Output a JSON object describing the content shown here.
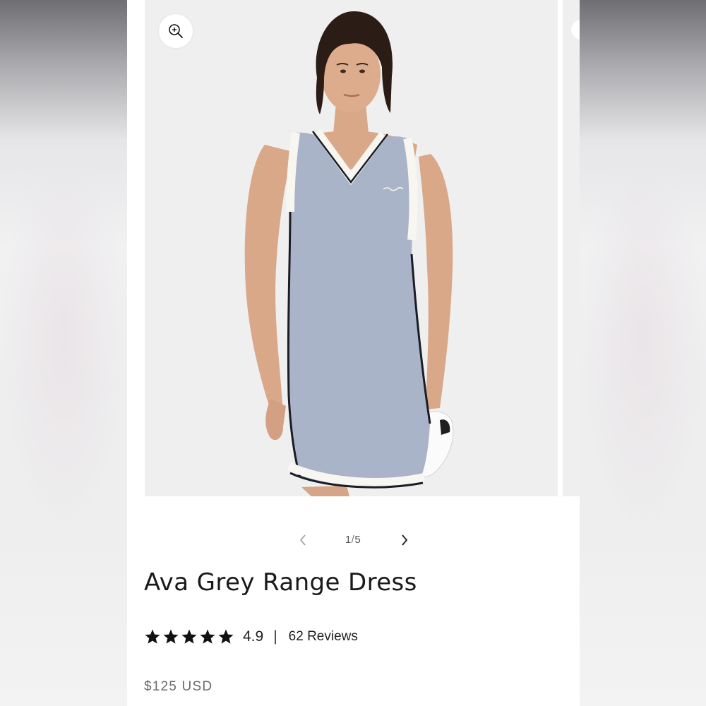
{
  "gallery": {
    "zoom_icon": "zoom-in-icon",
    "current_slide": "1",
    "separator": "/",
    "total_slides": "5",
    "prev_icon": "chevron-left-icon",
    "next_icon": "chevron-right-icon"
  },
  "product": {
    "title": "Ava Grey Range Dress",
    "rating": {
      "stars": 5,
      "value": "4.9",
      "separator": "|",
      "reviews_label": "62 Reviews"
    },
    "price": "$125 USD"
  },
  "colors": {
    "dress": "#a9b3c8",
    "trim": "#f7f6f0",
    "piping": "#1b1d24",
    "backdrop": "#efefef",
    "skin": "#d9a889",
    "hair": "#2b1c16"
  }
}
